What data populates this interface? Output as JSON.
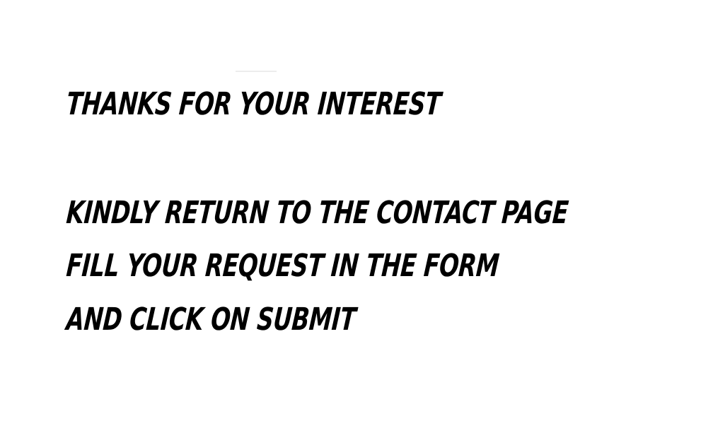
{
  "message": {
    "heading": "THANKS FOR YOUR INTEREST",
    "instructions": [
      "KINDLY RETURN TO THE CONTACT PAGE",
      "FILL YOUR REQUEST IN THE FORM",
      "AND CLICK ON SUBMIT"
    ]
  },
  "colors": {
    "background": "#ffffff",
    "text": "#000000"
  }
}
